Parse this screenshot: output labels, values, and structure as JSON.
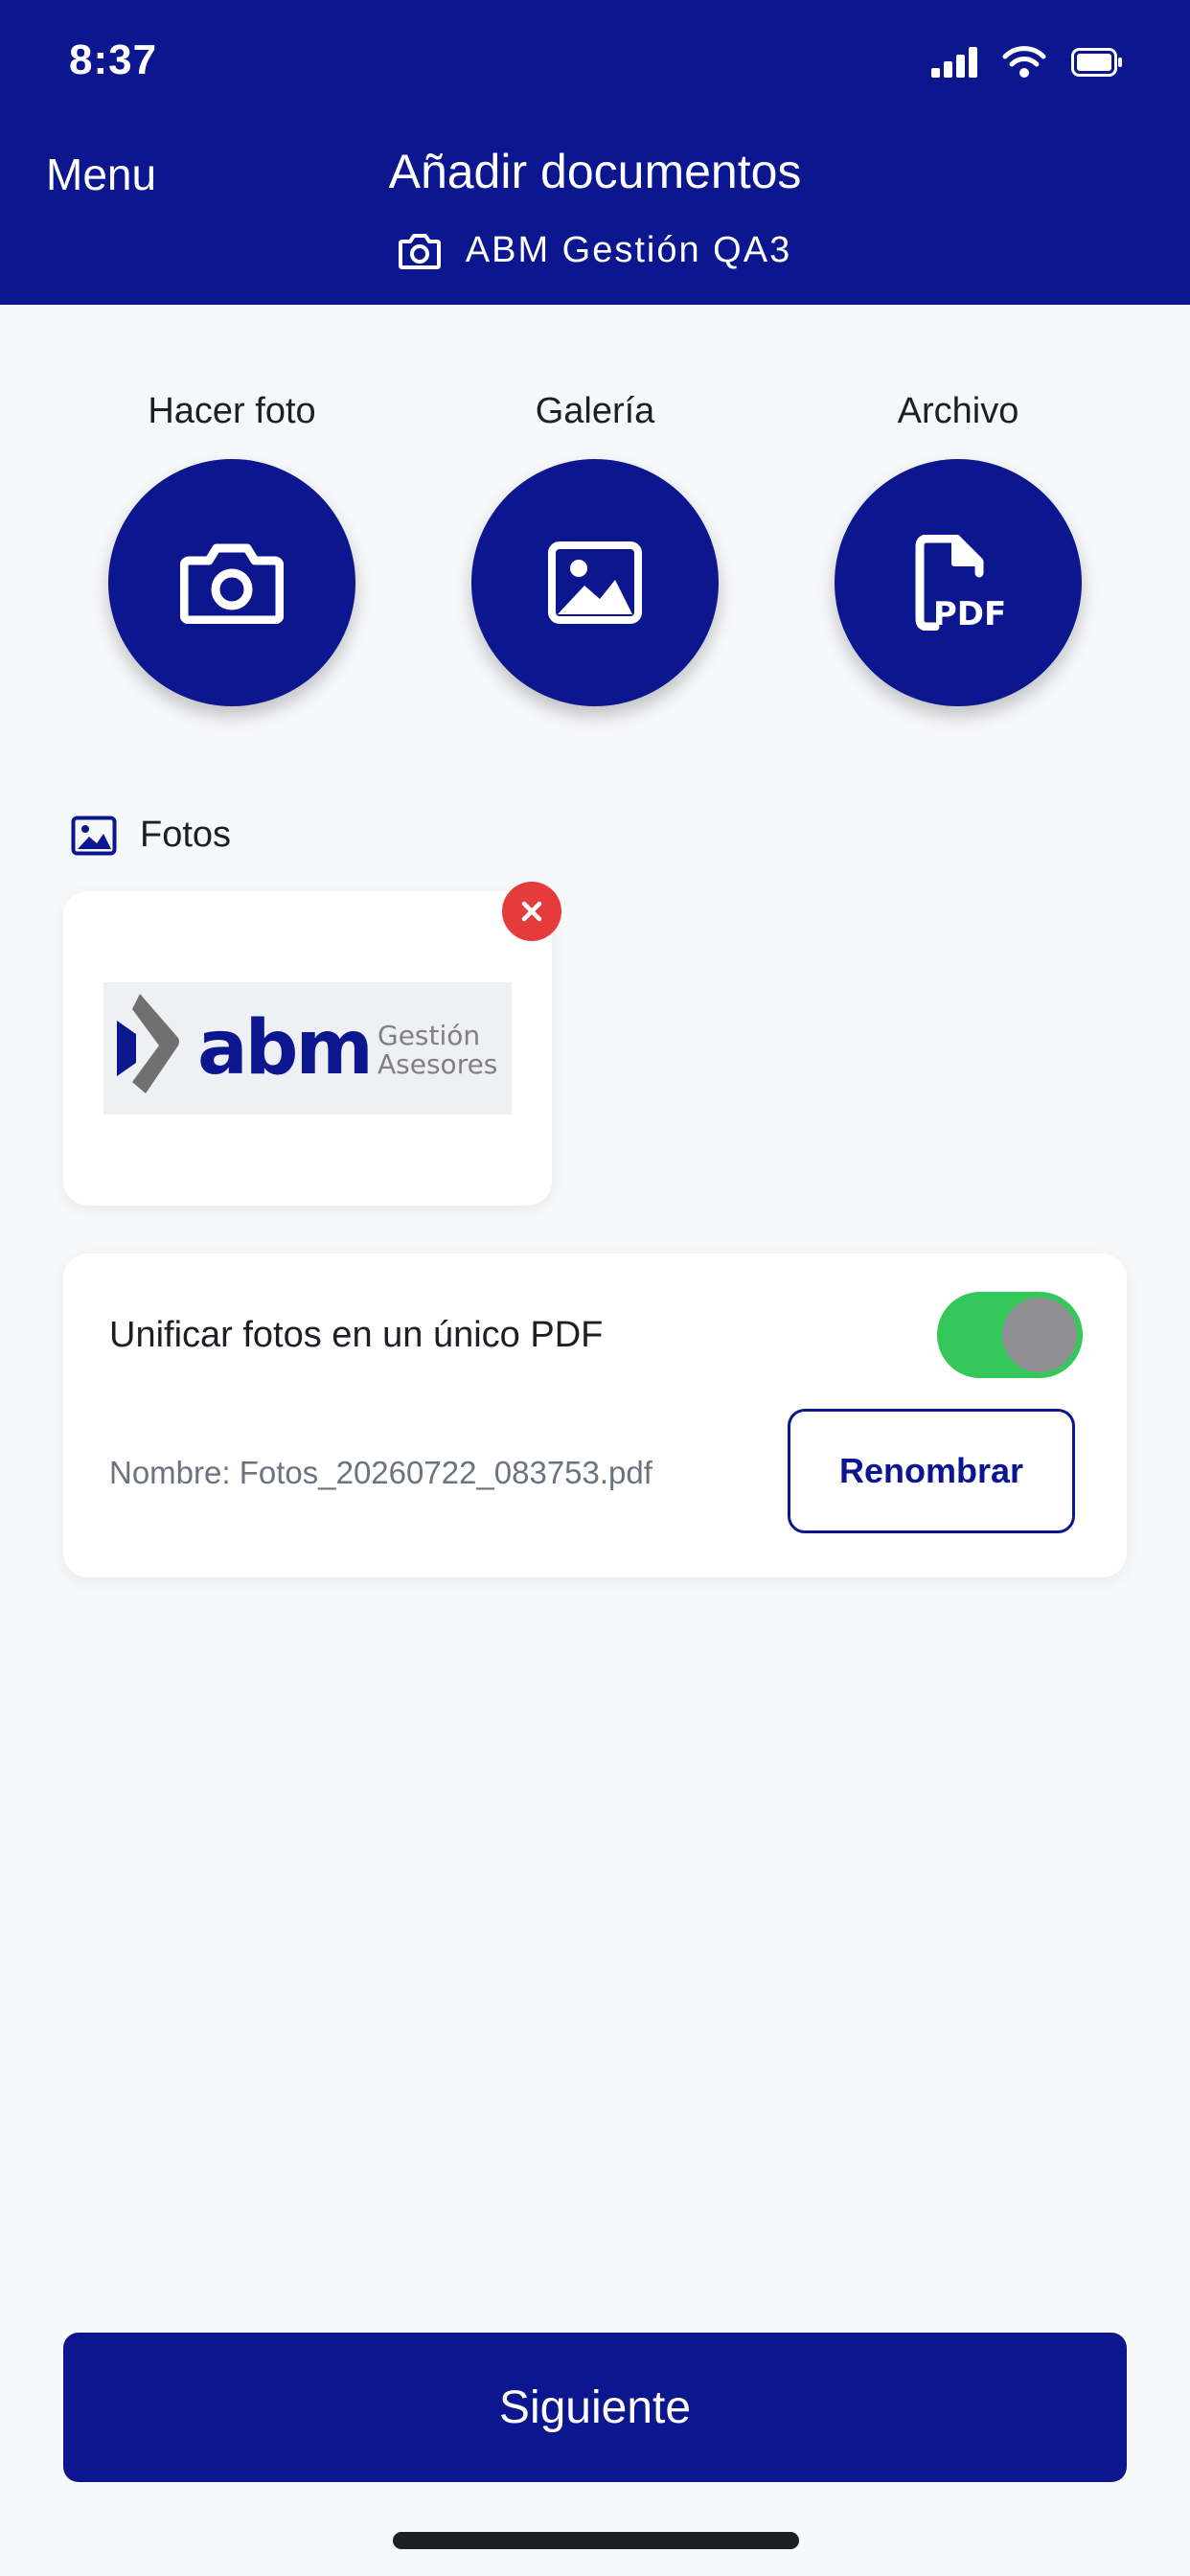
{
  "status_bar": {
    "time": "8:37"
  },
  "header": {
    "menu_label": "Menu",
    "title": "Añadir documentos",
    "subtitle": "ABM Gestión QA3"
  },
  "actions": [
    {
      "label": "Hacer foto",
      "icon": "camera-icon"
    },
    {
      "label": "Galería",
      "icon": "image-icon"
    },
    {
      "label": "Archivo",
      "icon": "pdf-file-icon"
    }
  ],
  "photos_section": {
    "title": "Fotos",
    "items": [
      {
        "logo_text": "abm",
        "logo_line1": "Gestión",
        "logo_line2": "Asesores"
      }
    ]
  },
  "unify": {
    "label": "Unificar fotos en un único PDF",
    "enabled": true,
    "filename_text": "Nombre: Fotos_20260722_083753.pdf",
    "rename_label": "Renombrar"
  },
  "footer": {
    "next_label": "Siguiente"
  },
  "colors": {
    "primary": "#0b168f",
    "toggle_on": "#34c759",
    "remove": "#e53b3b"
  }
}
